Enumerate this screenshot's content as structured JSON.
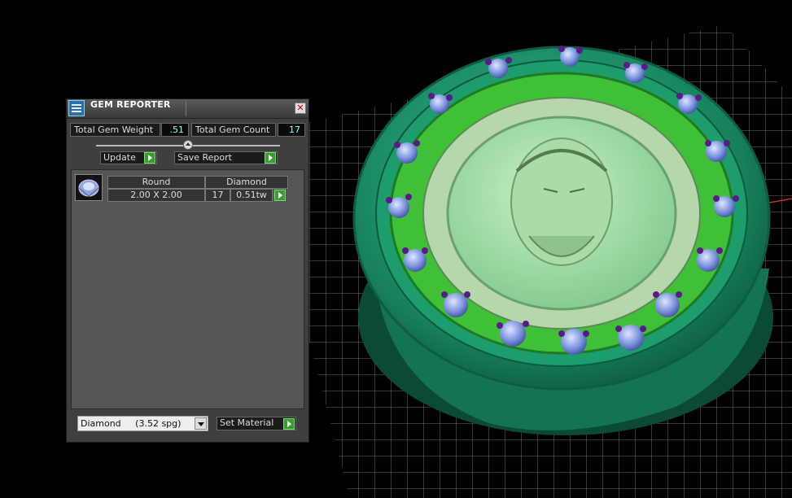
{
  "window": {
    "title": "GEM REPORTER",
    "close_symbol": "✕"
  },
  "stats": {
    "weight_label": "Total Gem Weight",
    "weight_value": ".51",
    "count_label": "Total Gem Count",
    "count_value": "17"
  },
  "toolbar": {
    "update_label": "Update",
    "save_report_label": "Save Report"
  },
  "gems": [
    {
      "cut": "Round",
      "material": "Diamond",
      "size": "2.00 X 2.00",
      "count": "17",
      "weight": "0.51tw"
    }
  ],
  "material_select": {
    "name": "Diamond",
    "spg": "(3.52 spg)"
  },
  "set_material_label": "Set Material",
  "icons": [
    "app-icon",
    "close-icon",
    "slider-knob-icon",
    "play-arrow-icon",
    "round-gem-icon",
    "dropdown-arrow-icon"
  ],
  "colors": {
    "panel_bg": "#3f3f3f",
    "value_text": "#88ffff",
    "arrow_button": "#3c9b2f",
    "model_green": "#1f9a70",
    "gem_blue": "#6f8fd8",
    "prong_purple": "#5a1a8a"
  }
}
